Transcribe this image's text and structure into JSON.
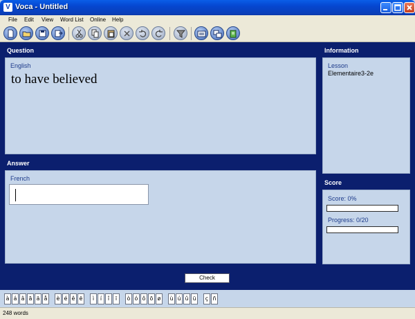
{
  "window": {
    "title": "Voca - Untitled",
    "icon_letter": "V"
  },
  "menu": [
    "File",
    "Edit",
    "View",
    "Word List",
    "Online",
    "Help"
  ],
  "toolbar_icons": [
    "new-file-icon",
    "open-folder-icon",
    "save-icon",
    "export-icon",
    "cut-icon",
    "copy-icon",
    "paste-icon",
    "delete-icon",
    "undo-icon",
    "redo-icon",
    "filter-icon",
    "list-view-icon",
    "transfer-icon",
    "edit-book-icon"
  ],
  "question": {
    "title": "Question",
    "language": "English",
    "text": "to have believed"
  },
  "answer": {
    "title": "Answer",
    "language": "French",
    "value": ""
  },
  "information": {
    "title": "Information",
    "lesson_label": "Lesson",
    "lesson_value": "Elementaire3-2e"
  },
  "score": {
    "title": "Score",
    "score_text": "Score: 0%",
    "score_fraction": 0,
    "progress_text": "Progress: 0/20",
    "progress_fraction": 0
  },
  "check_label": "Check",
  "accent_chars": [
    [
      "à",
      "á",
      "â",
      "ã",
      "ä",
      "å"
    ],
    [
      "è",
      "é",
      "ê",
      "ë"
    ],
    [
      "ì",
      "í",
      "î",
      "ï"
    ],
    [
      "ò",
      "ó",
      "ô",
      "õ",
      "ø"
    ],
    [
      "ù",
      "ú",
      "û",
      "ü"
    ],
    [
      "ç",
      "ñ"
    ]
  ],
  "status": "248 words",
  "colors": {
    "frame": "#0b1f6e",
    "panel": "#c6d6ea",
    "label": "#1c3a8a",
    "titlebar": "#0546d0"
  }
}
